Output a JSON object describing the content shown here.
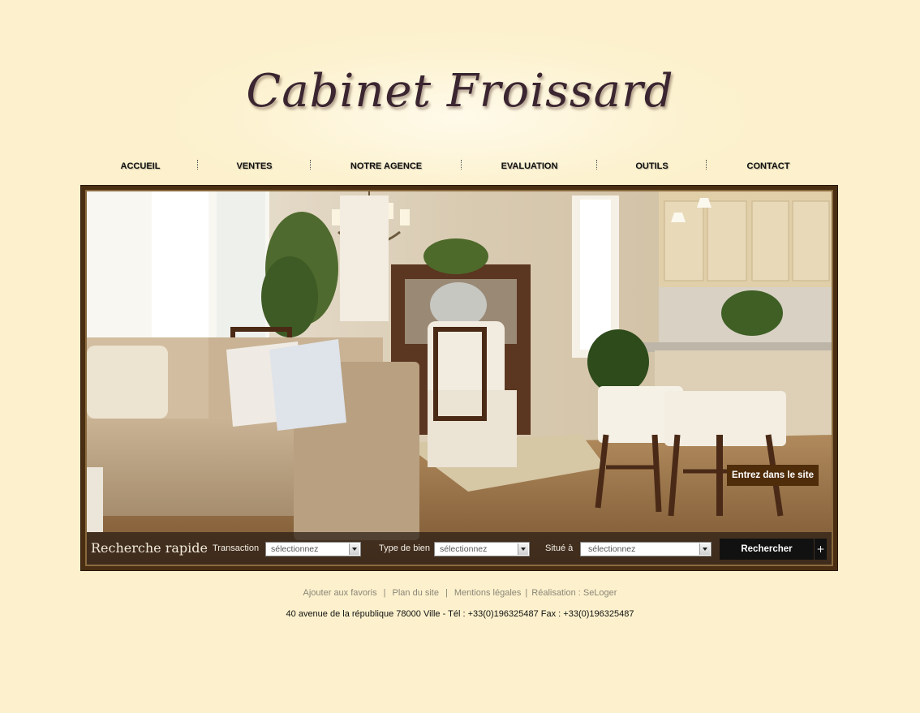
{
  "logo": {
    "text": "Cabinet Froissard"
  },
  "nav": {
    "items": [
      {
        "label": "ACCUEIL"
      },
      {
        "label": "VENTES"
      },
      {
        "label": "NOTRE AGENCE"
      },
      {
        "label": "EVALUATION"
      },
      {
        "label": "OUTILS"
      },
      {
        "label": "CONTACT"
      }
    ]
  },
  "hero": {
    "enter_label": "Entrez dans le site"
  },
  "search": {
    "title": "Recherche rapide",
    "transaction_label": "Transaction",
    "transaction_value": "sélectionnez",
    "type_label": "Type de bien",
    "type_value": "sélectionnez",
    "location_label": "Situé à",
    "location_value": "sélectionnez",
    "submit_label": "Rechercher",
    "more_label": "+"
  },
  "footer": {
    "links": [
      {
        "label": "Ajouter aux favoris"
      },
      {
        "label": "Plan du site"
      },
      {
        "label": "Mentions légales"
      },
      {
        "label": "Réalisation : SeLoger"
      }
    ],
    "separators": [
      "|",
      "|",
      "|"
    ],
    "address": "40 avenue de la république  78000 Ville   -   Tél : +33(0)196325487 Fax : +33(0)196325487"
  },
  "colors": {
    "page_bg": "#fcf1cc",
    "frame": "#4a2e12",
    "enter_button_bg": "#4f2c0a",
    "search_button_bg": "#111111"
  }
}
